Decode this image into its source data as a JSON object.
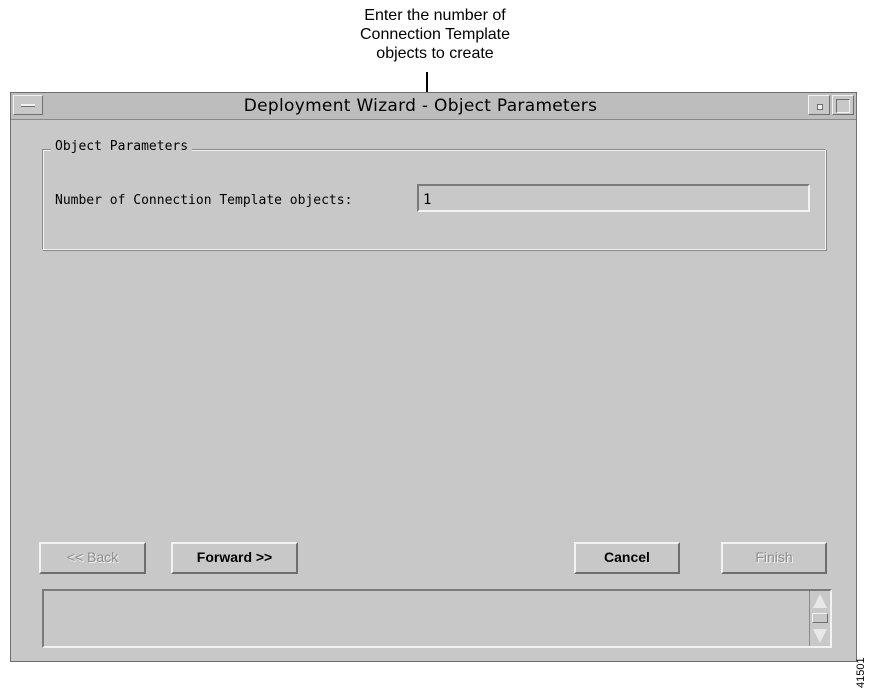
{
  "callout": {
    "lines": [
      "Enter the number of",
      "Connection Template",
      "objects to create"
    ]
  },
  "window": {
    "title": "Deployment Wizard - Object Parameters"
  },
  "group": {
    "title": "Object Parameters",
    "field_label": "Number of Connection Template objects:",
    "field_value": "1"
  },
  "buttons": {
    "back": "<< Back",
    "forward": "Forward >>",
    "cancel": "Cancel",
    "finish": "Finish"
  },
  "figure_id": "41501"
}
